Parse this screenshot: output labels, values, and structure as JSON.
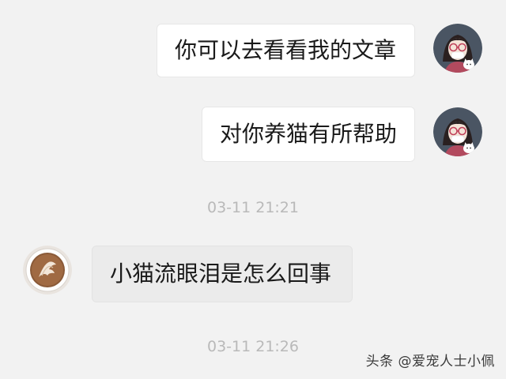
{
  "messages": [
    {
      "side": "sent",
      "text": "你可以去看看我的文章"
    },
    {
      "side": "sent",
      "text": "对你养猫有所帮助"
    },
    {
      "side": "received",
      "text": "小猫流眼泪是怎么回事"
    }
  ],
  "timestamps": [
    "03-11 21:21",
    "03-11 21:26"
  ],
  "watermark": "头条 @爱宠人士小佩",
  "avatars": {
    "self": "girl-with-glasses-and-cat-avatar",
    "other": "latte-art-coffee-avatar"
  },
  "colors": {
    "background": "#f2f2f2",
    "sent_bubble": "#ffffff",
    "received_bubble": "#ebebeb",
    "timestamp_text": "#b9b9b9"
  }
}
